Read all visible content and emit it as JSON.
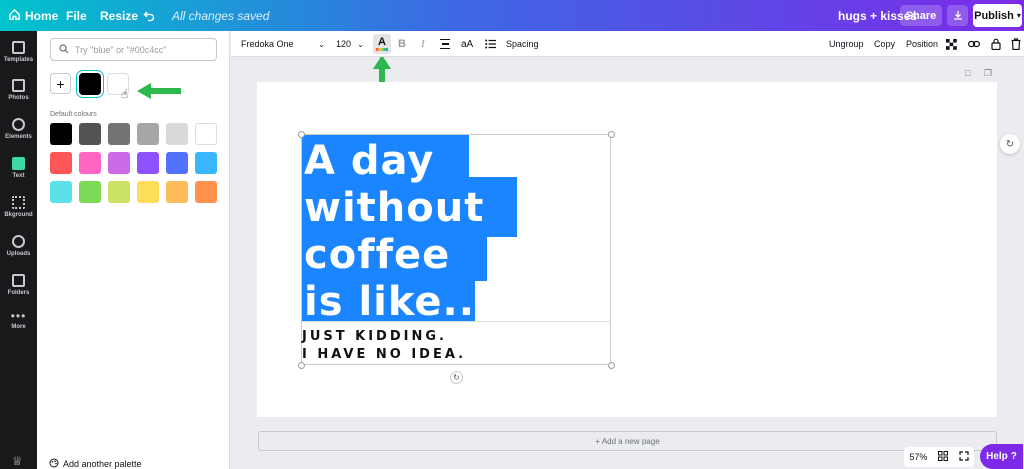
{
  "topbar": {
    "home": "Home",
    "file": "File",
    "resize": "Resize",
    "saved_status": "All changes saved",
    "document_title": "hugs + kisses",
    "share": "Share",
    "publish": "Publish"
  },
  "sidebar": {
    "items": [
      {
        "label": "Templates",
        "icon": "templates-icon"
      },
      {
        "label": "Photos",
        "icon": "photos-icon"
      },
      {
        "label": "Elements",
        "icon": "elements-icon"
      },
      {
        "label": "Text",
        "icon": "text-icon"
      },
      {
        "label": "Bkground",
        "icon": "background-icon"
      },
      {
        "label": "Uploads",
        "icon": "uploads-icon"
      },
      {
        "label": "Folders",
        "icon": "folders-icon"
      },
      {
        "label": "More",
        "icon": "more-icon"
      }
    ]
  },
  "color_panel": {
    "search_placeholder": "Try \"blue\" or \"#00c4cc\"",
    "document_colors": [
      "#000000",
      "#ffffff"
    ],
    "default_label": "Default colours",
    "default_colors": [
      "#000000",
      "#545454",
      "#737373",
      "#a6a6a6",
      "#d9d9d9",
      "#ffffff",
      "#ff5757",
      "#ff66c4",
      "#cb6ce6",
      "#8c52ff",
      "#5271ff",
      "#38b6ff",
      "#5ce1e6",
      "#7ed957",
      "#c9e265",
      "#ffde59",
      "#ffbd59",
      "#ff914d"
    ],
    "add_palette": "Add another palette"
  },
  "toolbar": {
    "font": "Fredoka One",
    "size": "120",
    "text_color_letter": "A",
    "bold": "B",
    "italic": "I",
    "case": "aA",
    "spacing": "Spacing",
    "ungroup": "Ungroup",
    "copy": "Copy",
    "position": "Position"
  },
  "canvas": {
    "headline_lines": [
      "A day",
      "without",
      "coffee",
      "is like..."
    ],
    "subtext_lines": [
      "JUST KIDDING.",
      "I HAVE NO IDEA."
    ],
    "highlight_color": "#1a85ff",
    "add_page": "+ Add a new page",
    "zoom": "57%"
  },
  "help": "Help",
  "annotation_color": "#2db84d"
}
